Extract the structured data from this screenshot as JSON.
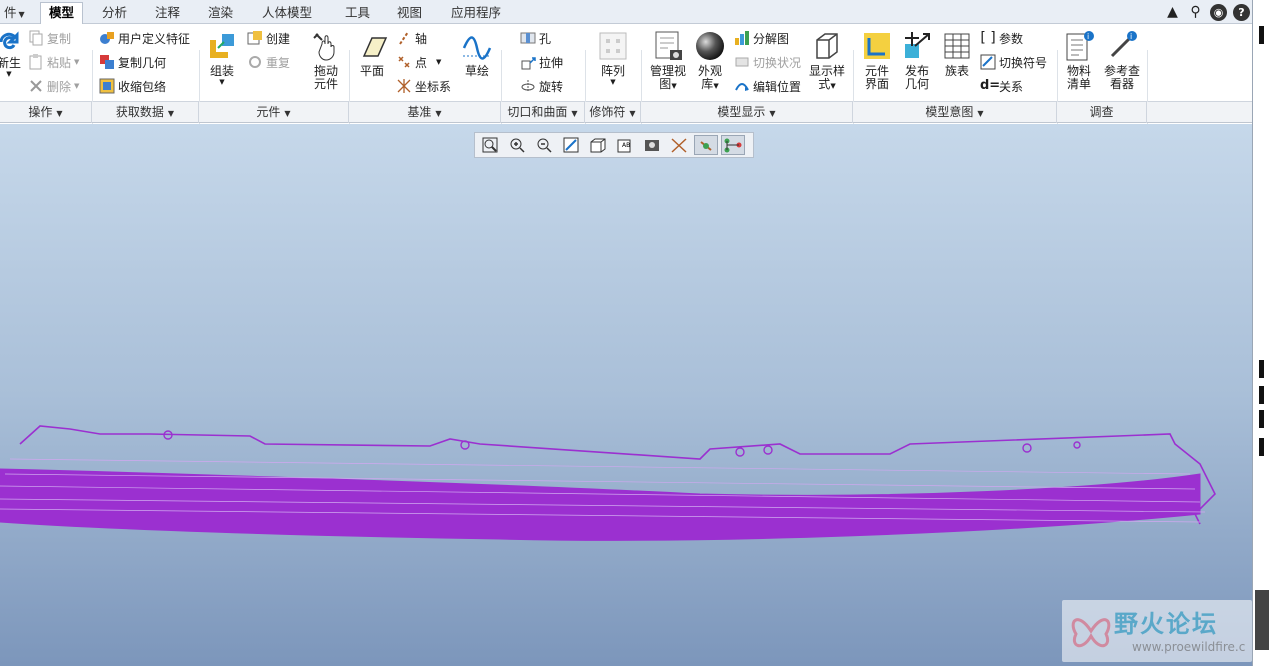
{
  "tabs": {
    "file": "件",
    "model": "模型",
    "analysis": "分析",
    "annotate": "注释",
    "render": "渲染",
    "manikin": "人体模型",
    "tools": "工具",
    "view": "视图",
    "apps": "应用程序"
  },
  "ops": {
    "regen": "新生",
    "copy": "复制",
    "paste": "粘贴",
    "delete": "删除",
    "group": "操作"
  },
  "data": {
    "udf": "用户定义特征",
    "copygeom": "复制几何",
    "shrinkwrap": "收缩包络",
    "group": "获取数据"
  },
  "comp": {
    "assemble": "组装",
    "create": "创建",
    "repeat": "重复",
    "group": "元件"
  },
  "drag": {
    "label1": "拖动",
    "label2": "元件"
  },
  "datum": {
    "plane": "平面",
    "axis": "轴",
    "point": "点",
    "csys": "坐标系",
    "sketch": "草绘",
    "group": "基准"
  },
  "cut": {
    "hole": "孔",
    "extrude": "拉伸",
    "revolve": "旋转",
    "group": "切口和曲面"
  },
  "modifier": {
    "group": "修饰符",
    "pattern": "阵列"
  },
  "display": {
    "manage1": "管理视",
    "manage2": "图",
    "appear1": "外观",
    "appear2": "库",
    "explode": "分解图",
    "toggle": "切换状况",
    "editpos": "编辑位置",
    "style1": "显示样",
    "style2": "式",
    "group": "模型显示"
  },
  "intent": {
    "iface1": "元件",
    "iface2": "界面",
    "publish1": "发布",
    "publish2": "几何",
    "family": "族表",
    "params": "参数",
    "switchsym": "切换符号",
    "relations": "关系",
    "group": "模型意图"
  },
  "investigate": {
    "bom1": "物料",
    "bom2": "清单",
    "ref1": "参考查",
    "ref2": "看器",
    "group": "调查"
  },
  "watermark": {
    "title": "野火论坛",
    "url": "www.proewildfire.c"
  },
  "colors": {
    "model": "#9b30d0",
    "accent": "#1a73c8"
  }
}
